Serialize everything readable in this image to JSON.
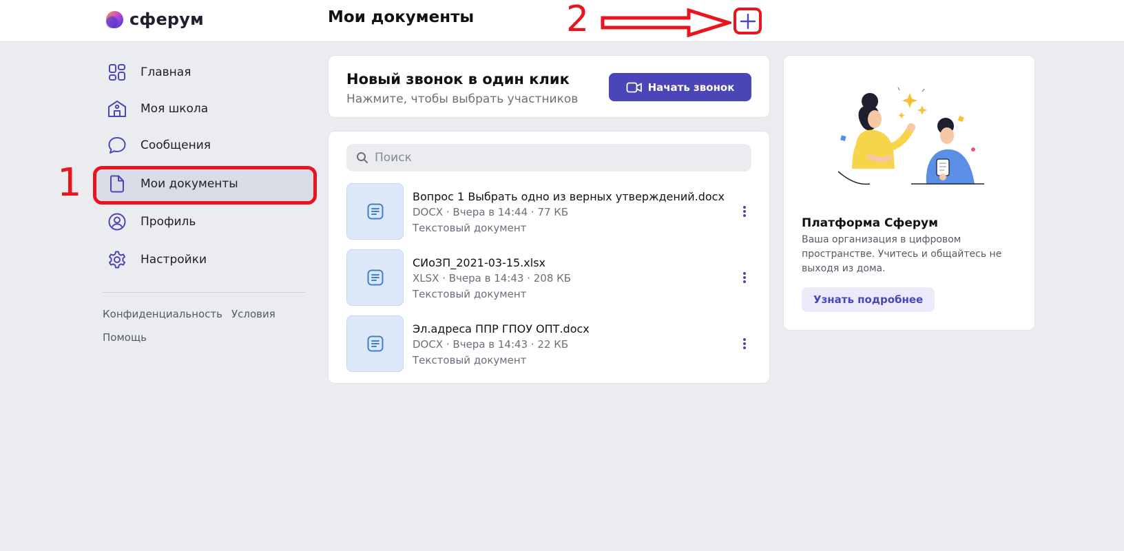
{
  "header": {
    "logo_text": "сферум",
    "page_title": "Мои документы",
    "add_icon": "plus-icon"
  },
  "annotations": {
    "step1": "1",
    "step2": "2",
    "color": "#e8141e"
  },
  "sidebar": {
    "items": [
      {
        "label": "Главная",
        "icon": "home-grid-icon"
      },
      {
        "label": "Моя школа",
        "icon": "school-icon"
      },
      {
        "label": "Сообщения",
        "icon": "chat-bubble-icon"
      },
      {
        "label": "Мои документы",
        "icon": "document-icon",
        "active": true
      },
      {
        "label": "Профиль",
        "icon": "profile-icon"
      },
      {
        "label": "Настройки",
        "icon": "gear-icon"
      }
    ],
    "footer_links": [
      "Конфиденциальность",
      "Условия",
      "Помощь"
    ]
  },
  "call_card": {
    "title": "Новый звонок в один клик",
    "subtitle": "Нажмите, чтобы выбрать участников",
    "button_label": "Начать звонок",
    "button_color": "#4b46b8"
  },
  "search": {
    "placeholder": "Поиск"
  },
  "documents": [
    {
      "name": "Вопрос 1 Выбрать одно из верных утверждений.docx",
      "meta": "DOCX · Вчера в 14:44 · 77 КБ",
      "type": "Текстовый документ"
    },
    {
      "name": "СИоЗП_2021-03-15.xlsx",
      "meta": "XLSX · Вчера в 14:43 · 208 КБ",
      "type": "Текстовый документ"
    },
    {
      "name": "Эл.адреса ППР ГПОУ ОПТ.docx",
      "meta": "DOCX · Вчера в 14:43 · 22 КБ",
      "type": "Текстовый документ"
    }
  ],
  "promo": {
    "title": "Платформа Сферум",
    "text": "Ваша организация в цифровом пространстве. Учитесь и общайтесь не выходя из дома.",
    "button_label": "Узнать подробнее"
  }
}
